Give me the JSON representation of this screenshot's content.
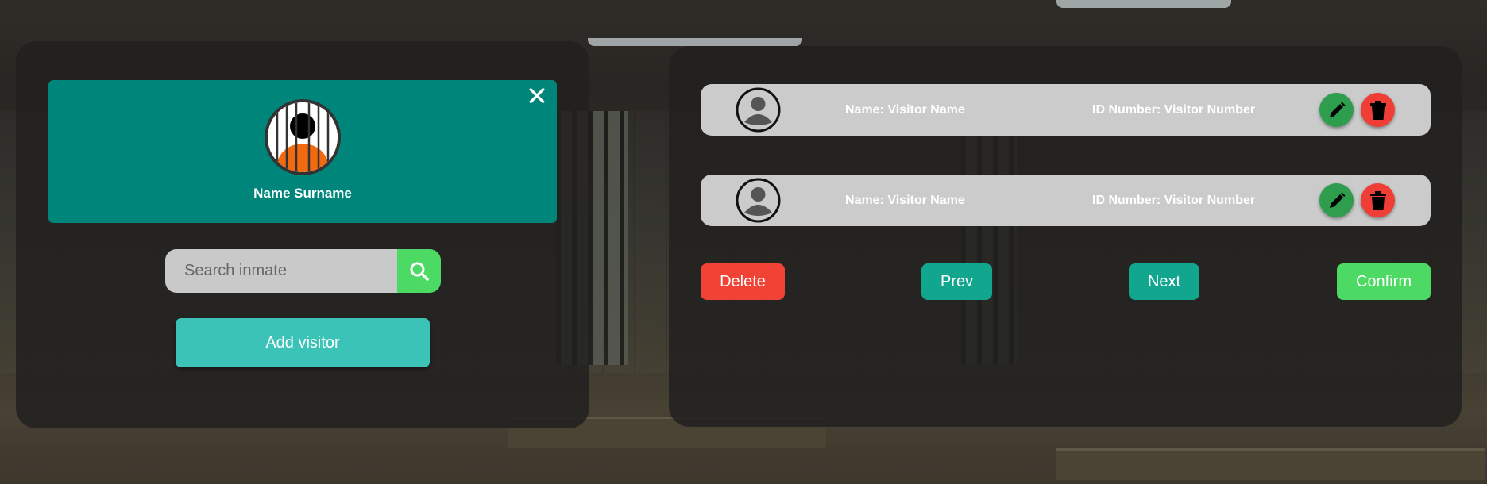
{
  "inmate": {
    "name": "Name Surname",
    "close_icon": "close-icon"
  },
  "search": {
    "placeholder": "Search inmate",
    "icon": "search-icon"
  },
  "add_visitor_label": "Add visitor",
  "visitors": [
    {
      "name": "Name: Visitor Name",
      "id": "ID Number: Visitor Number"
    },
    {
      "name": "Name: Visitor Name",
      "id": "ID Number: Visitor Number"
    }
  ],
  "actions": {
    "delete": "Delete",
    "prev": "Prev",
    "next": "Next",
    "confirm": "Confirm"
  },
  "colors": {
    "card": "#00857a",
    "search_button": "#4cd964",
    "add_visitor": "#3cc3b7",
    "delete": "#f04235",
    "nav": "#13a68f",
    "confirm": "#4cd964",
    "edit": "#2e9e4e"
  }
}
